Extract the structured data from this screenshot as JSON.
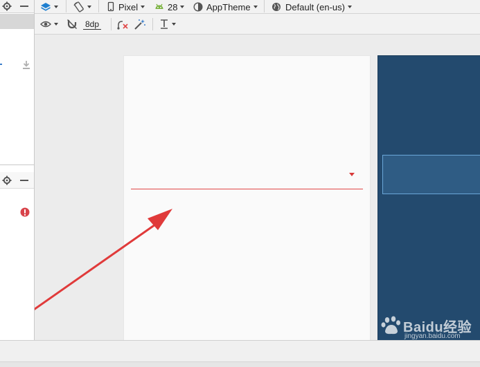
{
  "toolbar": {
    "device_label": "Pixel",
    "api_level_label": "28",
    "theme_label": "AppTheme",
    "locale_label": "Default (en-us)",
    "margin_label": "8dp"
  },
  "icons": {
    "layers": "layers-icon",
    "orientation": "rotate-device-icon",
    "device": "phone-icon",
    "android": "android-icon",
    "theme": "theme-icon",
    "locale": "globe-icon",
    "view_options": "eye-icon",
    "autoconnect": "magnet-icon",
    "clear_constraints": "clear-constraints-icon",
    "infer_constraints": "magic-wand-icon",
    "guidelines": "text-baseline-icon",
    "settings": "gear-icon",
    "hide": "minimize-icon",
    "download": "download-icon",
    "error": "error-icon"
  },
  "colors": {
    "accent_red": "#e04545",
    "blueprint": "#234a6e",
    "blueprint_outline": "#6aa7d8",
    "layers_blue": "#1f7fd0",
    "android_green": "#7cb342"
  },
  "watermark": {
    "text": "Baidu经验",
    "subtext": "jingyan.baidu.com"
  }
}
